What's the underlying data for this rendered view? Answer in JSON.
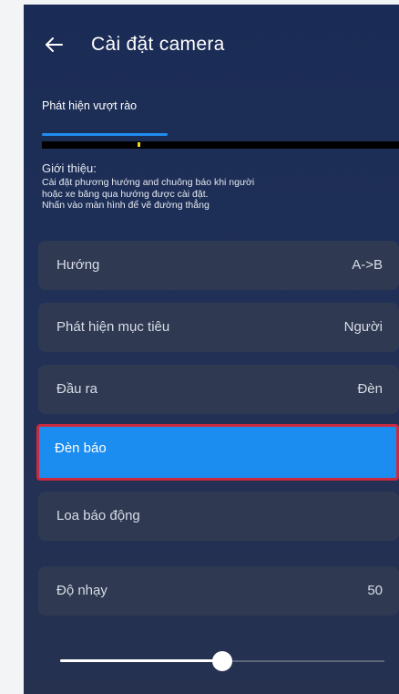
{
  "header": {
    "back_icon": "arrow-left-icon",
    "title": "Cài đặt camera"
  },
  "tabs": [
    {
      "label": "Phát hiện vượt rào",
      "active": true
    }
  ],
  "intro": {
    "title": "Giới thiệu:",
    "lines": [
      "Cài đặt phương hướng and chuông báo khi người",
      "hoặc xe băng qua hướng được cài đặt.",
      "Nhấn vào màn hình để vẽ đường thẳng"
    ]
  },
  "settings": [
    {
      "label": "Hướng",
      "value": "A->B"
    },
    {
      "label": "Phát hiện mục tiêu",
      "value": "Người"
    },
    {
      "label": "Đầu ra",
      "value": "Đèn"
    },
    {
      "label": "Đèn báo",
      "value": "",
      "selected": true
    },
    {
      "label": "Loa báo động",
      "value": ""
    }
  ],
  "sensitivity": {
    "label": "Độ nhạy",
    "value": "50",
    "slider_fraction": 0.5
  },
  "colors": {
    "accent": "#1b8cf0",
    "selection_border": "#cc2a3e",
    "row_background": "#2f3a52",
    "marker": "#f5d318"
  }
}
